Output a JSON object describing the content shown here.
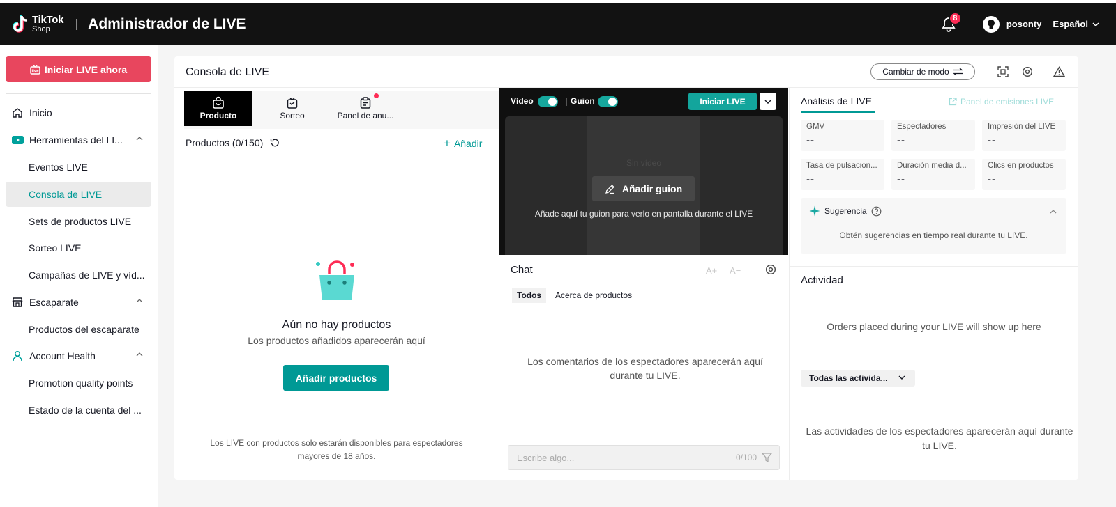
{
  "header": {
    "logo_line1": "TikTok",
    "logo_line2": "Shop",
    "title": "Administrador de LIVE",
    "notification_count": "8",
    "username": "posonty",
    "language": "Español"
  },
  "sidebar": {
    "start_live_label": "Iniciar LIVE ahora",
    "items": [
      {
        "label": "Inicio"
      },
      {
        "label": "Herramientas del LI..."
      },
      {
        "label": "Eventos LIVE"
      },
      {
        "label": "Consola de LIVE"
      },
      {
        "label": "Sets de productos LIVE"
      },
      {
        "label": "Sorteo LIVE"
      },
      {
        "label": "Campañas de LIVE y víd..."
      },
      {
        "label": "Escaparate"
      },
      {
        "label": "Productos del escaparate"
      },
      {
        "label": "Account Health"
      },
      {
        "label": "Promotion quality points"
      },
      {
        "label": "Estado de la cuenta del ..."
      }
    ]
  },
  "console": {
    "title": "Consola de LIVE",
    "mode_button": "Cambiar de modo"
  },
  "products": {
    "tabs": [
      {
        "label": "Producto"
      },
      {
        "label": "Sorteo"
      },
      {
        "label": "Panel de anu..."
      }
    ],
    "header": "Productos (0/150)",
    "add_link": "Añadir",
    "empty_title": "Aún no hay productos",
    "empty_subtitle": "Los productos añadidos aparecerán aquí",
    "add_button": "Añadir productos",
    "age_note": "Los LIVE con productos solo estarán disponibles para espectadores mayores de 18 años."
  },
  "video": {
    "video_toggle_label": "Vídeo",
    "script_toggle_label": "Guion",
    "start_live_button": "Iniciar LIVE",
    "no_video_text": "Sin vídeo",
    "add_script_button": "Añadir guion",
    "script_hint": "Añade aquí tu guion para verlo en pantalla durante el LIVE"
  },
  "chat": {
    "title": "Chat",
    "font_up": "A+",
    "font_down": "A−",
    "filters": [
      {
        "label": "Todos"
      },
      {
        "label": "Acerca de productos"
      }
    ],
    "empty_text": "Los comentarios de los espectadores aparecerán aquí durante tu LIVE.",
    "input_placeholder": "Escribe algo...",
    "char_count": "0/100"
  },
  "analysis": {
    "tab_label": "Análisis de LIVE",
    "panel_link": "Panel de emisiones LIVE",
    "metrics": [
      {
        "label": "GMV",
        "value": "--"
      },
      {
        "label": "Espectadores",
        "value": "--"
      },
      {
        "label": "Impresión del LIVE",
        "value": "--"
      },
      {
        "label": "Tasa de pulsacion...",
        "value": "--"
      },
      {
        "label": "Duración media d...",
        "value": "--"
      },
      {
        "label": "Clics en productos",
        "value": "--"
      }
    ],
    "suggestion_title": "Sugerencia",
    "suggestion_text": "Obtén sugerencias en tiempo real durante tu LIVE."
  },
  "activity": {
    "title": "Actividad",
    "orders_empty": "Orders placed during your LIVE will show up here",
    "filter_label": "Todas las activida...",
    "empty_text": "Las actividades de los espectadores aparecerán aquí durante tu LIVE."
  },
  "colors": {
    "accent": "#009995",
    "live_red": "#e8465e",
    "header_bg": "#121212"
  }
}
